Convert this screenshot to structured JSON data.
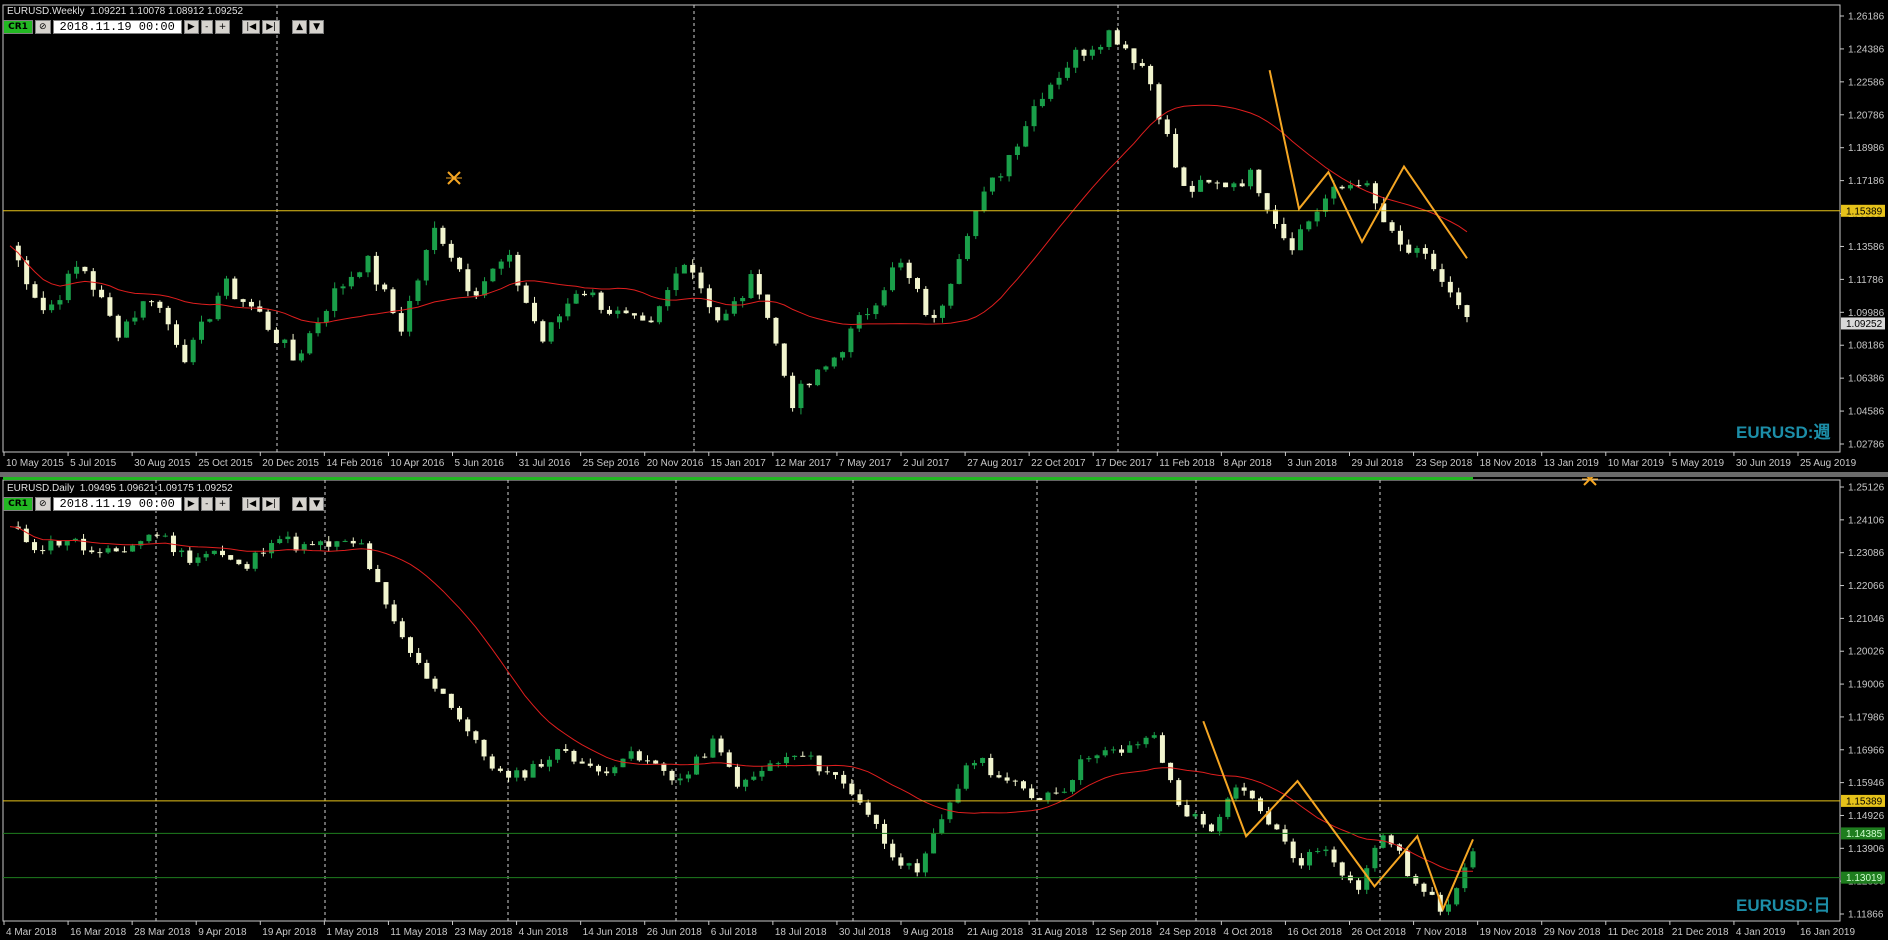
{
  "colors": {
    "bull": "#1a9f4a",
    "bear": "#f2f5cf",
    "ma": "#e01e1e",
    "zigzag": "#f5a623",
    "hline": "#e6c21a",
    "green_line": "#1e7d1e",
    "grid": "#c8c8c8"
  },
  "top": {
    "title": "EURUSD.Weekly  1.09221 1.10078 1.08912 1.09252",
    "cr_label": "CR1",
    "cr2_label": "⊘",
    "datetime": "2018.11.19 00:00",
    "nav_buttons": [
      "▶",
      "-",
      "+",
      "|◀",
      "▶|",
      "▲",
      "▼"
    ],
    "symbol_label": "EURUSD:週",
    "y_ticks": [
      "1.26186",
      "1.24386",
      "1.22586",
      "1.20786",
      "1.18986",
      "1.17186",
      "1.15386",
      "1.13586",
      "1.11786",
      "1.09986",
      "1.08186",
      "1.06386",
      "1.04586",
      "1.02786"
    ],
    "price_tags": [
      {
        "text": "1.15389",
        "kind": "hline"
      },
      {
        "text": "1.09252",
        "kind": "current"
      }
    ],
    "x_ticks": [
      "10 May 2015",
      "5 Jul 2015",
      "30 Aug 2015",
      "25 Oct 2015",
      "20 Dec 2015",
      "14 Feb 2016",
      "10 Apr 2016",
      "5 Jun 2016",
      "31 Jul 2016",
      "25 Sep 2016",
      "20 Nov 2016",
      "15 Jan 2017",
      "12 Mar 2017",
      "7 May 2017",
      "2 Jul 2017",
      "27 Aug 2017",
      "22 Oct 2017",
      "17 Dec 2017",
      "11 Feb 2018",
      "8 Apr 2018",
      "3 Jun 2018",
      "29 Jul 2018",
      "23 Sep 2018",
      "18 Nov 2018",
      "13 Jan 2019",
      "10 Mar 2019",
      "5 May 2019",
      "30 Jun 2019",
      "25 Aug 2019"
    ],
    "series_knots": [
      1.135,
      1.098,
      1.126,
      1.088,
      1.108,
      1.073,
      1.114,
      1.098,
      1.072,
      1.106,
      1.128,
      1.09,
      1.146,
      1.11,
      1.128,
      1.083,
      1.113,
      1.098,
      1.088,
      1.13,
      1.092,
      1.119,
      1.05,
      1.069,
      1.096,
      1.126,
      1.092,
      1.148,
      1.18,
      1.218,
      1.239,
      1.252,
      1.23,
      1.165,
      1.168,
      1.173,
      1.135,
      1.16,
      1.172,
      1.135,
      1.125,
      1.092
    ],
    "hline_value": 1.15389,
    "zigzag": [
      [
        8,
        1.2305
      ],
      [
        15,
        1.155
      ],
      [
        22,
        1.175
      ],
      [
        30,
        1.137
      ],
      [
        40,
        1.178
      ],
      [
        55,
        1.128
      ]
    ]
  },
  "bottom": {
    "title": "EURUSD.Daily  1.09495 1.09621 1.09175 1.09252",
    "cr_label": "CR1",
    "cr2_label": "⊘",
    "datetime": "2018.11.19 00:00",
    "nav_buttons": [
      "▶",
      "-",
      "+",
      "|◀",
      "▶|",
      "▲",
      "▼"
    ],
    "symbol_label": "EURUSD:日",
    "y_ticks": [
      "1.25126",
      "1.24106",
      "1.23086",
      "1.22066",
      "1.21046",
      "1.20026",
      "1.19006",
      "1.17986",
      "1.16966",
      "1.15946",
      "1.14926",
      "1.13906",
      "1.12886",
      "1.11866"
    ],
    "price_tags": [
      {
        "text": "1.15389",
        "kind": "hline"
      },
      {
        "text": "1.14385",
        "kind": "green"
      },
      {
        "text": "1.13019",
        "kind": "green"
      }
    ],
    "x_ticks": [
      "4 Mar 2018",
      "16 Mar 2018",
      "28 Mar 2018",
      "9 Apr 2018",
      "19 Apr 2018",
      "1 May 2018",
      "11 May 2018",
      "23 May 2018",
      "4 Jun 2018",
      "14 Jun 2018",
      "26 Jun 2018",
      "6 Jul 2018",
      "18 Jul 2018",
      "30 Jul 2018",
      "9 Aug 2018",
      "21 Aug 2018",
      "31 Aug 2018",
      "12 Sep 2018",
      "24 Sep 2018",
      "4 Oct 2018",
      "16 Oct 2018",
      "26 Oct 2018",
      "7 Nov 2018",
      "19 Nov 2018",
      "29 Nov 2018",
      "11 Dec 2018",
      "21 Dec 2018",
      "4 Jan 2019",
      "16 Jan 2019"
    ],
    "series_knots": [
      1.238,
      1.232,
      1.235,
      1.229,
      1.232,
      1.237,
      1.229,
      1.231,
      1.225,
      1.236,
      1.232,
      1.233,
      1.233,
      1.21,
      1.195,
      1.185,
      1.17,
      1.16,
      1.165,
      1.17,
      1.162,
      1.168,
      1.165,
      1.16,
      1.172,
      1.158,
      1.165,
      1.168,
      1.163,
      1.155,
      1.14,
      1.13,
      1.152,
      1.168,
      1.16,
      1.155,
      1.158,
      1.17,
      1.168,
      1.175,
      1.152,
      1.145,
      1.158,
      1.148,
      1.135,
      1.14,
      1.126,
      1.145,
      1.128,
      1.12,
      1.14
    ],
    "hline_value": 1.15389,
    "green_lines": [
      1.14385,
      1.13019
    ],
    "zigzag": [
      [
        8,
        1.1785
      ],
      [
        18,
        1.143
      ],
      [
        30,
        1.16
      ],
      [
        48,
        1.1275
      ],
      [
        58,
        1.143
      ],
      [
        64,
        1.1205
      ],
      [
        71,
        1.142
      ]
    ]
  }
}
